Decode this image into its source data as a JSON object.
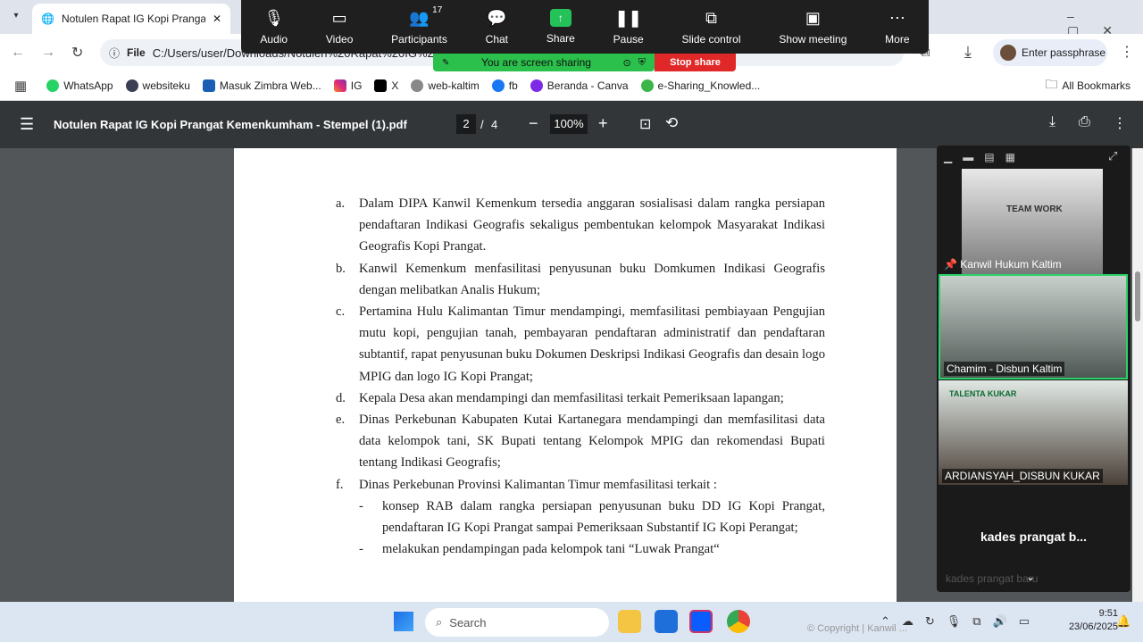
{
  "browser": {
    "tab_title": "Notulen Rapat IG Kopi Prangat",
    "address_prefix": "File",
    "address": "C:/Users/user/Downloads/Notulen%20Rapat%20IG%20...(1).pdf",
    "profile_label": "Enter passphrase",
    "bookmarks": [
      "WhatsApp",
      "websiteku",
      "Masuk Zimbra Web...",
      "IG",
      "X",
      "web-kaltim",
      "fb",
      "Beranda - Canva",
      "e-Sharing_Knowled..."
    ],
    "all_bookmarks": "All Bookmarks"
  },
  "pdf": {
    "title": "Notulen Rapat IG Kopi Prangat Kemenkumham - Stempel (1).pdf",
    "page_current": "2",
    "page_sep": "/",
    "page_total": "4",
    "zoom": "100%"
  },
  "document": {
    "items": [
      {
        "marker": "a.",
        "text": "Dalam DIPA Kanwil Kemenkum tersedia anggaran sosialisasi dalam rangka persiapan pendaftaran Indikasi Geografis sekaligus pembentukan kelompok Masyarakat Indikasi Geografis Kopi Prangat."
      },
      {
        "marker": "b.",
        "text": "Kanwil Kemenkum menfasilitasi penyusunan buku Domkumen Indikasi Geografis dengan melibatkan Analis Hukum;"
      },
      {
        "marker": "c.",
        "text": "Pertamina Hulu Kalimantan Timur mendampingi, memfasilitasi pembiayaan Pengujian mutu kopi, pengujian tanah, pembayaran pendaftaran administratif dan pendaftaran subtantif, rapat penyusunan buku Dokumen Deskripsi Indikasi Geografis dan desain logo MPIG dan logo IG Kopi Prangat;"
      },
      {
        "marker": "d.",
        "text": "Kepala Desa akan mendampingi dan memfasilitasi terkait Pemeriksaan lapangan;"
      },
      {
        "marker": "e.",
        "text": "Dinas Perkebunan Kabupaten Kutai Kartanegara mendampingi dan memfasilitasi data data kelompok tani, SK Bupati tentang Kelompok MPIG dan rekomendasi Bupati tentang Indikasi Geografis;"
      },
      {
        "marker": "f.",
        "text": "Dinas Perkebunan Provinsi Kalimantan Timur memfasilitasi terkait :"
      }
    ],
    "subitems": [
      {
        "marker": "-",
        "text": "konsep RAB dalam rangka persiapan penyusunan buku DD IG Kopi Prangat, pendaftaran IG Kopi Prangat sampai Pemeriksaan Substantif IG Kopi Perangat;"
      },
      {
        "marker": "-",
        "text": "melakukan pendampingan pada kelompok tani “Luwak Prangat“"
      }
    ]
  },
  "zoom": {
    "toolbar": [
      "Audio",
      "Video",
      "Participants",
      "Chat",
      "Share",
      "Pause",
      "Slide control",
      "Show meeting",
      "More"
    ],
    "participants_count": "17",
    "sharing_notice": "You are screen sharing",
    "stop_share": "Stop share",
    "participants": [
      {
        "name": "Kanwil Hukum Kaltim"
      },
      {
        "name": "Chamim - Disbun Kaltim"
      },
      {
        "name": "ARDIANSYAH_DISBUN KUKAR"
      },
      {
        "name": "kades prangat b..."
      },
      {
        "name": "kades prangat baru"
      }
    ],
    "poster_text": "TEAM WORK",
    "banner_text": "TALENTA KUKAR"
  },
  "taskbar": {
    "search": "Search",
    "time": "9:51",
    "date": "23/06/2025",
    "watermark": "© Copyright | Kanwil ..."
  }
}
